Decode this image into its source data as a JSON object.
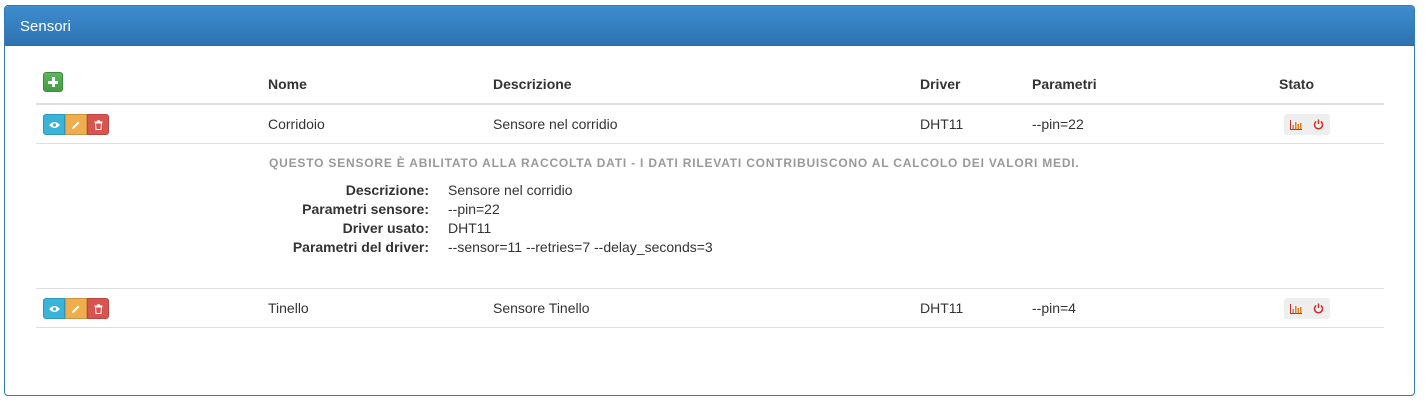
{
  "panel": {
    "title": "Sensori"
  },
  "table": {
    "headers": {
      "nome": "Nome",
      "descrizione": "Descrizione",
      "driver": "Driver",
      "parametri": "Parametri",
      "stato": "Stato"
    },
    "rows": [
      {
        "nome": "Corridoio",
        "descrizione": "Sensore nel corridio",
        "driver": "DHT11",
        "parametri": "--pin=22"
      },
      {
        "nome": "Tinello",
        "descrizione": "Sensore Tinello",
        "driver": "DHT11",
        "parametri": "--pin=4"
      }
    ],
    "detail": {
      "notice": "Questo sensore è abilitato alla raccolta dati - I dati rilevati contribuiscono al calcolo dei valori medi.",
      "labels": {
        "descrizione": "Descrizione:",
        "parametri_sensore": "Parametri sensore:",
        "driver_usato": "Driver usato:",
        "parametri_driver": "Parametri del driver:"
      },
      "values": {
        "descrizione": "Sensore nel corridio",
        "parametri_sensore": "--pin=22",
        "driver_usato": "DHT11",
        "parametri_driver": "--sensor=11 --retries=7 --delay_seconds=3"
      }
    }
  },
  "icons": {
    "add": "plus-icon",
    "view": "eye-icon",
    "edit": "pencil-icon",
    "delete": "trash-icon",
    "chart": "bar-chart-icon",
    "power": "power-icon"
  },
  "colors": {
    "primary": "#337ab7",
    "success": "#5cb85c",
    "info": "#39b3d7",
    "warning": "#f0ad4e",
    "danger": "#d9534f",
    "muted": "#999999"
  }
}
